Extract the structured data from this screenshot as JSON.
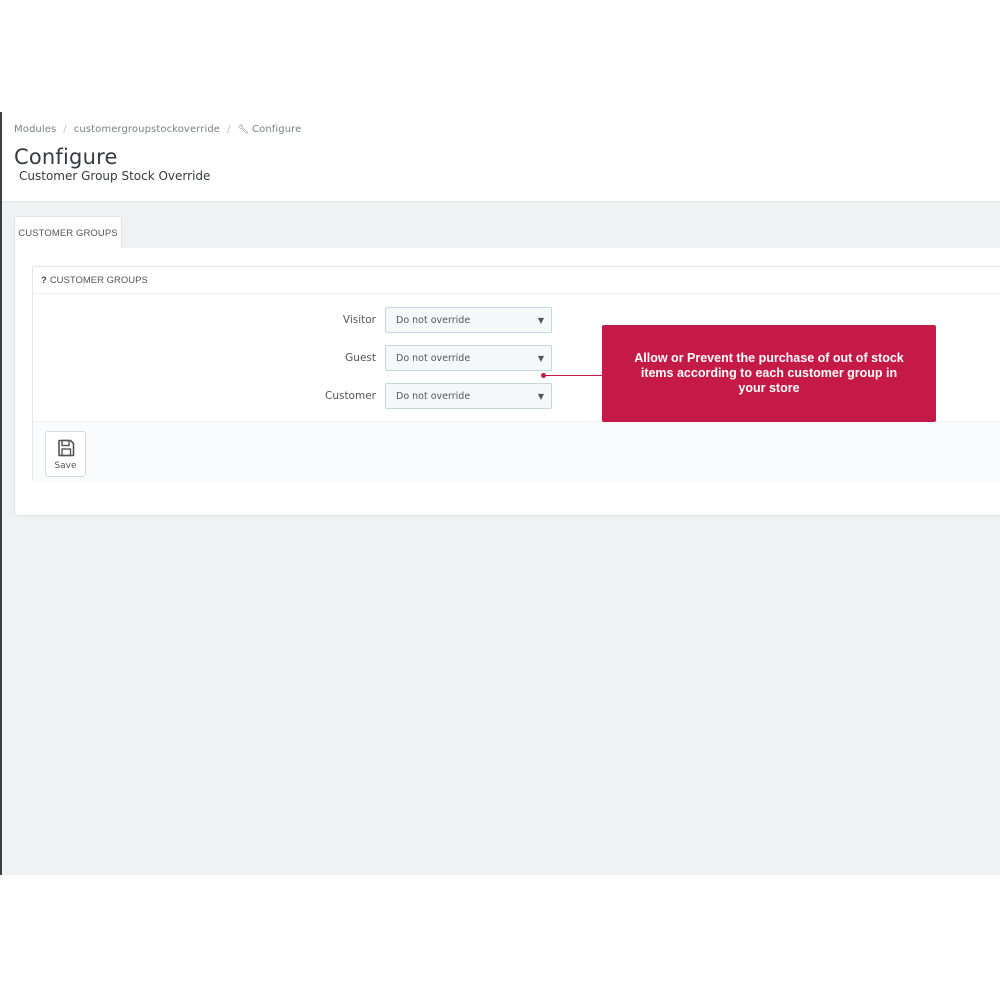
{
  "breadcrumb": {
    "items": [
      "Modules",
      "customergroupstockoverride",
      "Configure"
    ],
    "separator": "/"
  },
  "header": {
    "title": "Configure",
    "subtitle": "Customer Group Stock Override"
  },
  "tabs": [
    {
      "label": "CUSTOMER GROUPS",
      "active": true
    }
  ],
  "panel": {
    "heading_icon": "?",
    "heading": "CUSTOMER GROUPS",
    "rows": [
      {
        "label": "Visitor",
        "value": "Do not override"
      },
      {
        "label": "Guest",
        "value": "Do not override"
      },
      {
        "label": "Customer",
        "value": "Do not override"
      }
    ],
    "save_label": "Save"
  },
  "callout": {
    "text": "Allow or Prevent the purchase of out of stock items according to each customer group in your store"
  },
  "colors": {
    "callout": "#c51a47",
    "background": "#eff1f2",
    "select_border": "#c7d6db"
  },
  "icons": {
    "breadcrumb_configure": "wrench-icon",
    "select_caret": "caret-down-icon",
    "save": "floppy-disk-icon"
  }
}
